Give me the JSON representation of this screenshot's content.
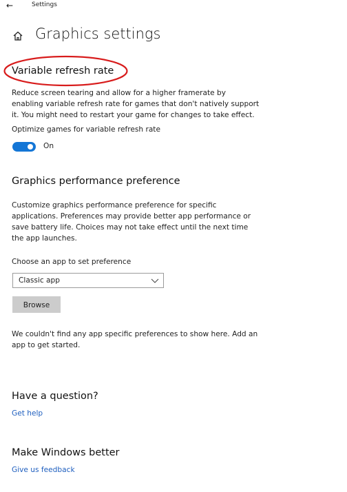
{
  "window": {
    "back_icon": "back-arrow-icon",
    "back_glyph": "←",
    "title": "Settings"
  },
  "header": {
    "home_icon": "home-icon",
    "title": "Graphics settings"
  },
  "variable_refresh_rate": {
    "heading": "Variable refresh rate",
    "highlight_color": "#d81c1c",
    "description": "Reduce screen tearing and allow for a higher framerate by enabling variable refresh rate for games that don't natively support it. You might need to restart your game for changes to take effect.",
    "toggle_label": "Optimize games for variable refresh rate",
    "toggle_state": "On",
    "toggle_color": "#1476d6"
  },
  "graphics_performance": {
    "heading": "Graphics performance preference",
    "description": "Customize graphics performance preference for specific applications. Preferences may provide better app performance or save battery life. Choices may not take effect until the next time the app launches.",
    "choose_label": "Choose an app to set preference",
    "dropdown_value": "Classic app",
    "dropdown_icon": "chevron-down-icon",
    "browse_label": "Browse",
    "no_prefs_text": "We couldn't find any app specific preferences to show here. Add an app to get started."
  },
  "question": {
    "heading": "Have a question?",
    "link": "Get help"
  },
  "feedback": {
    "heading": "Make Windows better",
    "link": "Give us feedback"
  },
  "colors": {
    "link": "#1f5fbf",
    "button_bg": "#cccccc"
  }
}
